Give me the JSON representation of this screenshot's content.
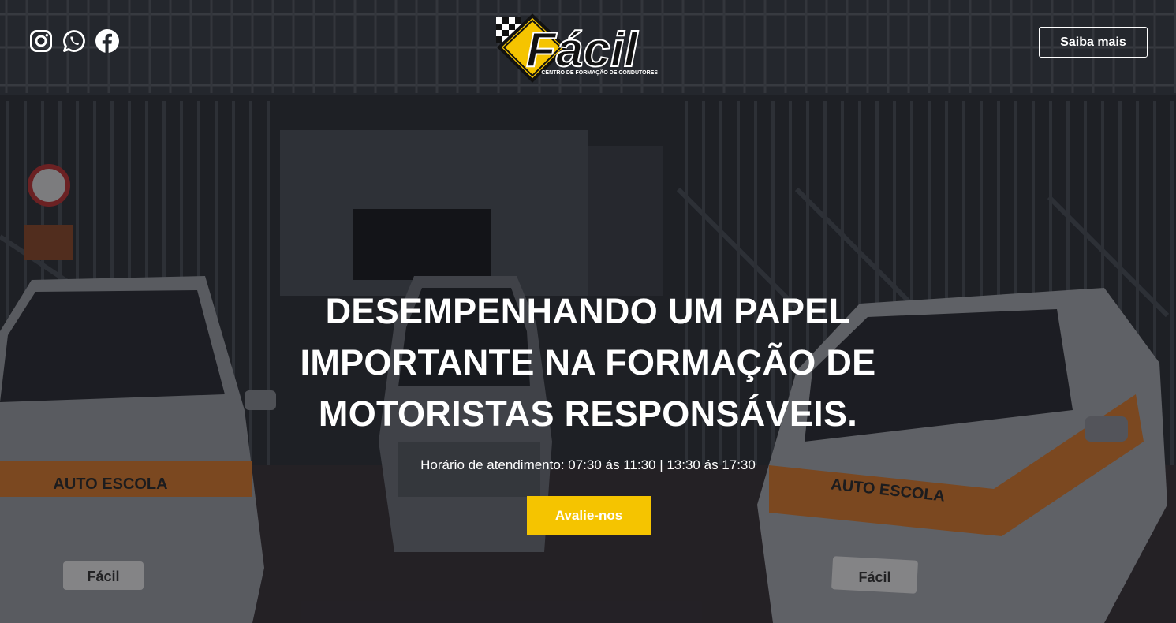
{
  "header": {
    "social": [
      {
        "icon": "instagram-icon"
      },
      {
        "icon": "whatsapp-icon"
      },
      {
        "icon": "facebook-icon"
      }
    ],
    "logo": {
      "name": "Fácil",
      "tagline": "CENTRO DE FORMAÇÃO DE CONDUTORES"
    },
    "cta_label": "Saiba mais"
  },
  "hero": {
    "headline_lines": [
      "DESEMPENHANDO UM PAPEL",
      "IMPORTANTE NA FORMAÇÃO DE",
      "MOTORISTAS RESPONSÁVEIS."
    ],
    "hours": "Horário de atendimento: 07:30 ás 11:30 | 13:30 ás 17:30",
    "button_label": "Avalie-nos"
  },
  "background": {
    "car_label": "AUTO ESCOLA",
    "plate_label": "Fácil"
  },
  "colors": {
    "accent": "#f5c400",
    "car_stripe": "#e8893a"
  }
}
